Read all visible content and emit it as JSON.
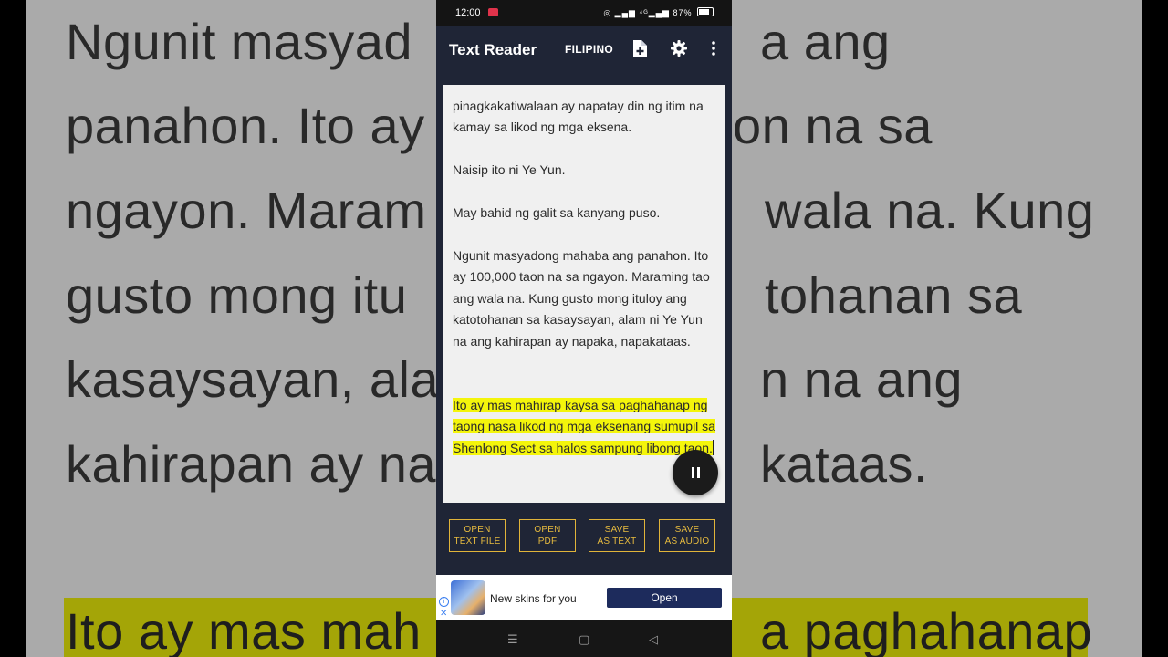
{
  "background": {
    "lines": [
      "Ngunit masyad",
      "a ang",
      "panahon. Ito ay",
      "on na sa",
      "ngayon. Maram",
      "wala na. Kung",
      "gusto mong itu",
      "tohanan sa",
      "kasaysayan, ala",
      "n na ang",
      "kahirapan ay na",
      "kataas.",
      "Ito ay mas mah",
      "a paghahanap"
    ],
    "highlight_color": "#e4e50a"
  },
  "status_bar": {
    "time": "12:00",
    "battery": "87%",
    "icons": "◎ ▂▄▆ ⁴ᴳ▂▄▆"
  },
  "app_bar": {
    "title": "Text Reader",
    "language": "FILIPINO",
    "icons": [
      "new-file-icon",
      "gear-icon",
      "more-vert-icon"
    ]
  },
  "reader": {
    "paragraphs": [
      "pinagkakatiwalaan ay napatay din ng itim na kamay sa likod ng mga eksena.",
      "Naisip ito ni Ye Yun.",
      "May bahid ng galit sa kanyang puso.",
      "Ngunit masyadong mahaba ang panahon. Ito ay 100,000 taon na sa ngayon. Maraming tao ang wala na. Kung gusto mong ituloy ang katotohanan sa kasaysayan, alam ni Ye Yun na ang kahirapan ay napaka, napakataas."
    ],
    "highlighted": "Ito ay mas mahirap kaysa sa paghahanap ng taong nasa likod ng mga eksenang sumupil sa Shenlong Sect sa halos sampung libong taon.",
    "highlight_color": "#f4f50b",
    "fab_icon": "pause-icon"
  },
  "actions": [
    {
      "line1": "OPEN",
      "line2": "TEXT FILE"
    },
    {
      "line1": "OPEN",
      "line2": "PDF"
    },
    {
      "line1": "SAVE",
      "line2": "AS TEXT"
    },
    {
      "line1": "SAVE",
      "line2": "AS AUDIO"
    }
  ],
  "accent_color": "#e7bb3f",
  "ad": {
    "headline": "New skins for you",
    "cta": "Open"
  },
  "nav": {
    "recents": "☰",
    "home": "▢",
    "back": "◁"
  }
}
